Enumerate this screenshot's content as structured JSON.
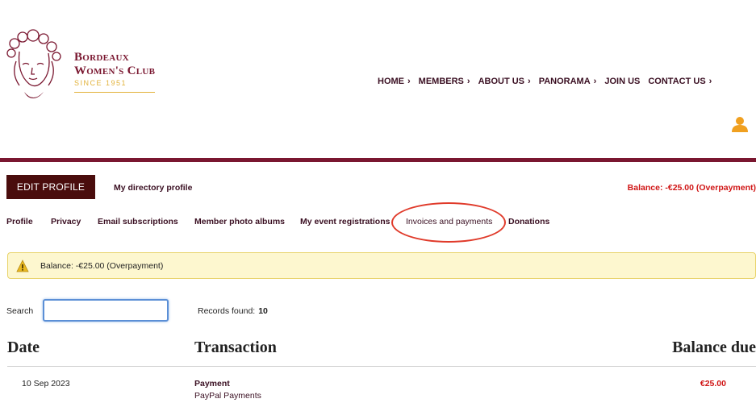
{
  "brand": {
    "line1": "Bordeaux",
    "line2": "Women's Club",
    "since": "SINCE 1951",
    "colors": {
      "maroon": "#7a1730",
      "gold": "#e2b23a",
      "alert_red": "#d01515",
      "user_orange": "#f0a020"
    }
  },
  "topnav": {
    "items": [
      {
        "label": "HOME",
        "chevron": "›"
      },
      {
        "label": "MEMBERS",
        "chevron": "›"
      },
      {
        "label": "ABOUT US",
        "chevron": "›"
      },
      {
        "label": "PANORAMA",
        "chevron": "›"
      },
      {
        "label": "JOIN US",
        "chevron": ""
      },
      {
        "label": "CONTACT US",
        "chevron": "›"
      }
    ]
  },
  "icons": {
    "user": "user-icon",
    "warning": "warning-icon"
  },
  "profile": {
    "edit_label": "EDIT PROFILE",
    "directory_label": "My directory profile",
    "balance_label": "Balance: -€25.00 (Overpayment)"
  },
  "subnav": {
    "items": [
      {
        "label": "Profile"
      },
      {
        "label": "Privacy"
      },
      {
        "label": "Email subscriptions"
      },
      {
        "label": "Member photo albums"
      },
      {
        "label": "My event registrations"
      },
      {
        "label": "Invoices and payments",
        "active": true
      },
      {
        "label": "Donations"
      }
    ]
  },
  "alert": {
    "text": "Balance: -€25.00 (Overpayment)"
  },
  "search": {
    "label": "Search",
    "value": "",
    "placeholder": ""
  },
  "records": {
    "label": "Records found:",
    "count": "10"
  },
  "table": {
    "headers": {
      "date": "Date",
      "transaction": "Transaction",
      "balance": "Balance due"
    },
    "rows": [
      {
        "date": "10 Sep 2023",
        "type": "Payment",
        "method": "PayPal Payments",
        "amount": "€25.00"
      }
    ]
  }
}
